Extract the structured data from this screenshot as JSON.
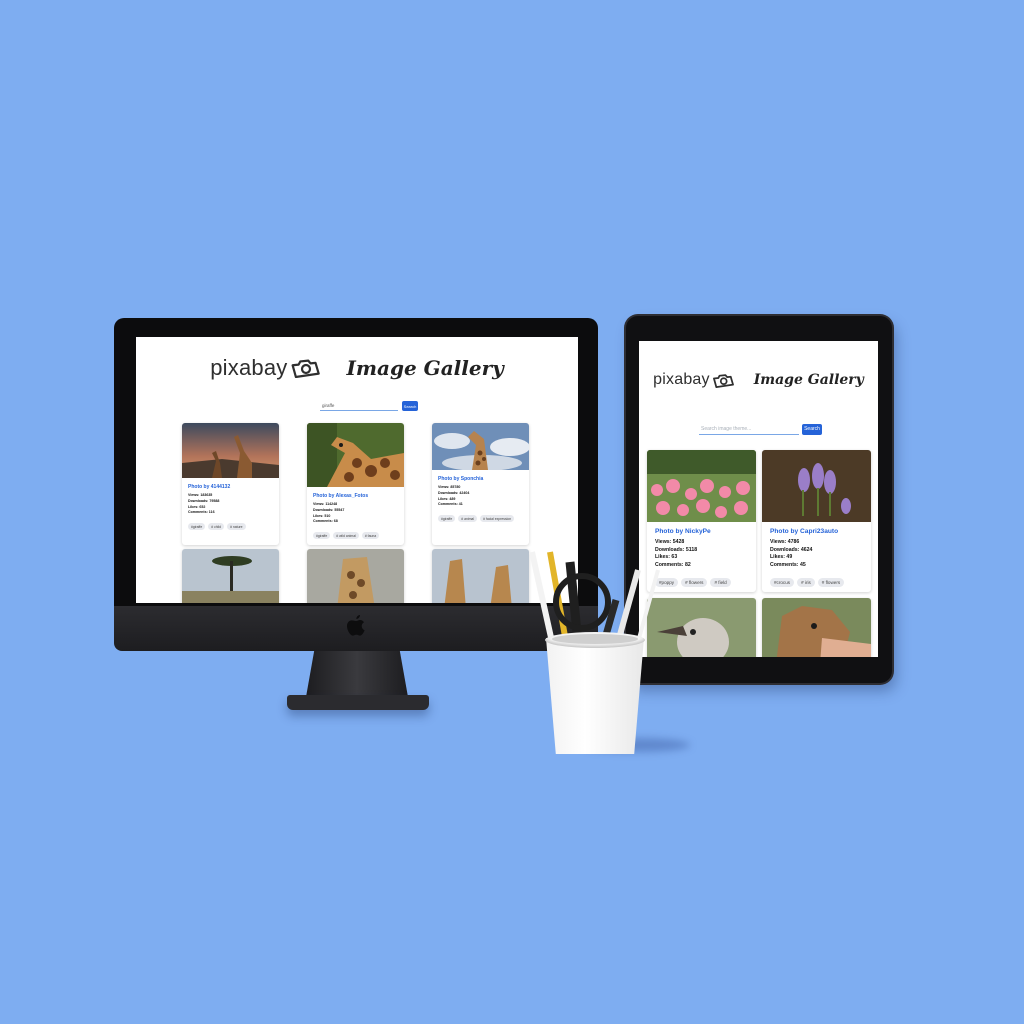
{
  "colors": {
    "background": "#7eadf1",
    "accent": "#2563d8"
  },
  "desktop": {
    "logo": "pixabay",
    "title": "Image Gallery",
    "search": {
      "value": "giraffe",
      "placeholder": "",
      "button": "Search"
    },
    "cards": [
      {
        "author": "Photo by 4144132",
        "views": "Views: 183635",
        "downloads": "Downloads: 79588",
        "likes": "Likes: 652",
        "comments": "Comments: 116",
        "tags": [
          "#giraffe",
          "# child",
          "# nature"
        ]
      },
      {
        "author": "Photo by Alexas_Fotos",
        "views": "Views: 114248",
        "downloads": "Downloads: 55547",
        "likes": "Likes: 510",
        "comments": "Comments: 68",
        "tags": [
          "#giraffe",
          "# wild animal",
          "# fauna"
        ]
      },
      {
        "author": "Photo by Sponchia",
        "views": "Views: 85780",
        "downloads": "Downloads: 42404",
        "likes": "Likes: 489",
        "comments": "Comments: 41",
        "tags": [
          "#giraffe",
          "# animal",
          "# facial expression"
        ]
      }
    ]
  },
  "tablet": {
    "logo": "pixabay",
    "title": "Image Gallery",
    "search": {
      "value": "",
      "placeholder": "Search image theme...",
      "button": "Search"
    },
    "cards": [
      {
        "author": "Photo by NickyPe",
        "views": "Views: 5428",
        "downloads": "Downloads: 5118",
        "likes": "Likes: 63",
        "comments": "Comments: 82",
        "tags": [
          "#poppy",
          "# flowers",
          "# field"
        ]
      },
      {
        "author": "Photo by Capri23auto",
        "views": "Views: 4786",
        "downloads": "Downloads: 4624",
        "likes": "Likes: 49",
        "comments": "Comments: 45",
        "tags": [
          "#crocus",
          "# iris",
          "# flowers"
        ]
      }
    ]
  }
}
